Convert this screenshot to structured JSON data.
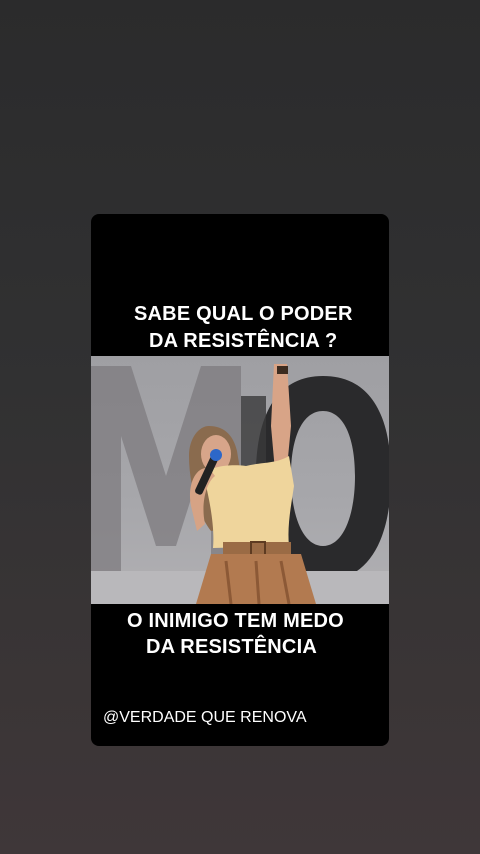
{
  "story": {
    "caption_top": [
      "SABE QUAL O PODER",
      "DA RESISTÊNCIA ?"
    ],
    "caption_bottom": [
      "O INIMIGO TEM MEDO",
      "DA RESISTÊNCIA"
    ],
    "watermark": "@VERDADE QUE RENOVA",
    "photo_icon": "woman-speaker-on-stage-image"
  },
  "colors": {
    "background": "#2f2f30",
    "card": "#000000",
    "text": "#ffffff"
  }
}
